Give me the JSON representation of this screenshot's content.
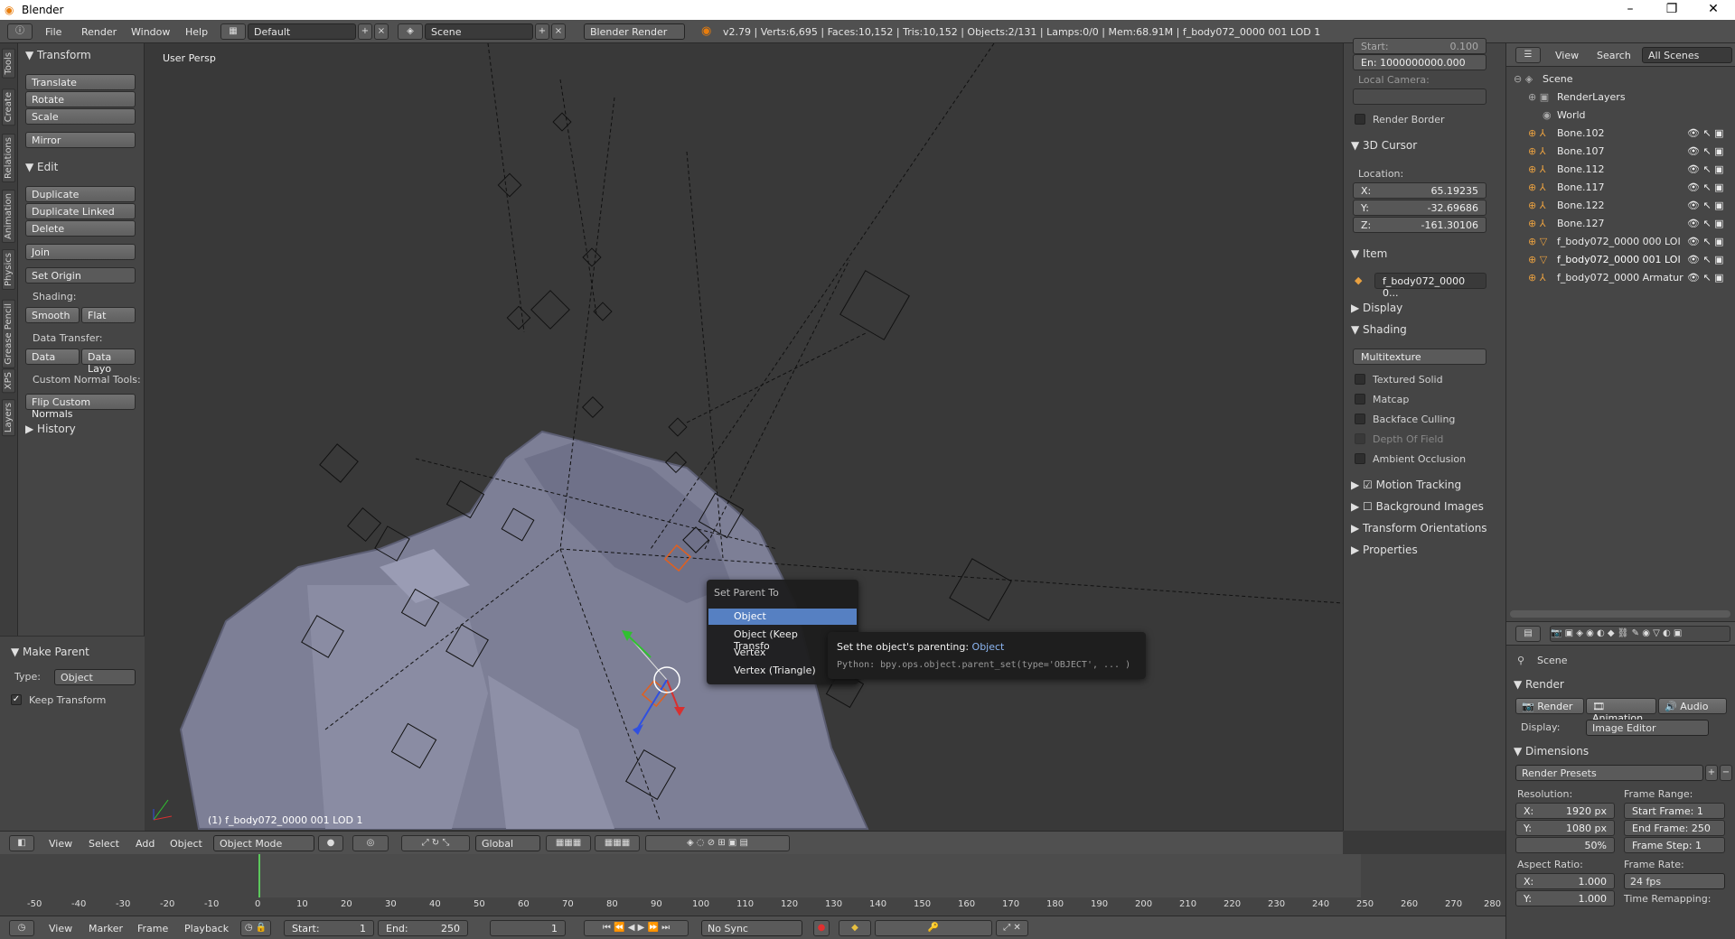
{
  "window": {
    "title": "Blender",
    "min": "–",
    "max": "❐",
    "close": "✕"
  },
  "menubar": {
    "file": "File",
    "render": "Render",
    "window": "Window",
    "help": "Help"
  },
  "header": {
    "layout": "Default",
    "scene": "Scene",
    "engine": "Blender Render",
    "stats": "v2.79 | Verts:6,695 | Faces:10,152 | Tris:10,152 | Objects:2/131 | Lamps:0/0 | Mem:68.91M | f_body072_0000 001 LOD 1"
  },
  "tool_tabs": [
    "Tools",
    "Create",
    "Relations",
    "Animation",
    "Physics",
    "Grease Pencil",
    "XPS",
    "Layers"
  ],
  "tools": {
    "transform_title": "Transform",
    "translate": "Translate",
    "rotate": "Rotate",
    "scale": "Scale",
    "mirror": "Mirror",
    "edit_title": "Edit",
    "duplicate": "Duplicate",
    "duplicate_linked": "Duplicate Linked",
    "delete": "Delete",
    "join": "Join",
    "set_origin": "Set Origin",
    "shading_label": "Shading:",
    "smooth": "Smooth",
    "flat": "Flat",
    "data_transfer_label": "Data Transfer:",
    "data": "Data",
    "data_layo": "Data Layo",
    "custom_normal_label": "Custom Normal Tools:",
    "flip_normals": "Flip Custom Normals",
    "history": "History"
  },
  "make_parent": {
    "title": "Make Parent",
    "type_label": "Type:",
    "type_value": "Object",
    "keep_transform": "Keep Transform"
  },
  "viewport": {
    "view_name": "User Persp",
    "object_label": "(1) f_body072_0000 001 LOD 1"
  },
  "context_menu": {
    "title": "Set Parent To",
    "items": [
      "Object",
      "Object (Keep Transfo",
      "Vertex",
      "Vertex (Triangle)"
    ]
  },
  "tooltip": {
    "text": "Set the object's parenting:",
    "value": "Object",
    "python": "Python: bpy.ops.object.parent_set(type='OBJECT', ... )"
  },
  "npanel": {
    "start": "Start:",
    "start_val": "0.100",
    "end": "En: 1000000000.000",
    "local_camera": "Local Camera:",
    "render_border": "Render Border",
    "cursor_title": "3D Cursor",
    "location": "Location:",
    "x": "X:",
    "x_val": "65.19235",
    "y": "Y:",
    "y_val": "-32.69686",
    "z": "Z:",
    "z_val": "-161.30106",
    "item_title": "Item",
    "item_name": "f_body072_0000 0...",
    "display": "Display",
    "shading": "Shading",
    "multitexture": "Multitexture",
    "textured_solid": "Textured Solid",
    "matcap": "Matcap",
    "backface": "Backface Culling",
    "dof": "Depth Of Field",
    "ao": "Ambient Occlusion",
    "motion": "Motion Tracking",
    "bg_images": "Background Images",
    "transform_orient": "Transform Orientations",
    "properties": "Properties"
  },
  "outliner": {
    "view": "View",
    "search": "Search",
    "scenes": "All Scenes",
    "rows": [
      "Scene",
      "RenderLayers",
      "World",
      "Bone.102",
      "Bone.107",
      "Bone.112",
      "Bone.117",
      "Bone.122",
      "Bone.127",
      "f_body072_0000 000 LOI",
      "f_body072_0000 001 LOI",
      "f_body072_0000 Armatur"
    ]
  },
  "props": {
    "scene": "Scene",
    "render_title": "Render",
    "render_btn": "Render",
    "animation_btn": "Animation",
    "audio_btn": "Audio",
    "display_label": "Display:",
    "display_value": "Image Editor",
    "dimensions": "Dimensions",
    "presets": "Render Presets",
    "resolution": "Resolution:",
    "res_x": "X:",
    "res_x_val": "1920 px",
    "res_y": "Y:",
    "res_y_val": "1080 px",
    "res_pct": "50%",
    "frame_range": "Frame Range:",
    "start_frame": "Start Frame: 1",
    "end_frame": "End Frame: 250",
    "frame_step": "Frame Step: 1",
    "aspect": "Aspect Ratio:",
    "asp_x": "X:",
    "asp_x_val": "1.000",
    "asp_y": "Y:",
    "asp_y_val": "1.000",
    "frame_rate": "Frame Rate:",
    "fps": "24 fps",
    "time_remap": "Time Remapping:"
  },
  "vp_header": {
    "view": "View",
    "select": "Select",
    "add": "Add",
    "object": "Object",
    "mode": "Object Mode",
    "orientation": "Global"
  },
  "timeline": {
    "ticks": [
      "-50",
      "-40",
      "-30",
      "-20",
      "-10",
      "0",
      "10",
      "20",
      "30",
      "40",
      "50",
      "60",
      "70",
      "80",
      "90",
      "100",
      "110",
      "120",
      "130",
      "140",
      "150",
      "160",
      "170",
      "180",
      "190",
      "200",
      "210",
      "220",
      "230",
      "240",
      "250",
      "260",
      "270",
      "280"
    ]
  },
  "tl_bar": {
    "view": "View",
    "marker": "Marker",
    "frame": "Frame",
    "playback": "Playback",
    "start": "Start:",
    "start_val": "1",
    "end": "End:",
    "end_val": "250",
    "current": "1",
    "sync": "No Sync"
  }
}
